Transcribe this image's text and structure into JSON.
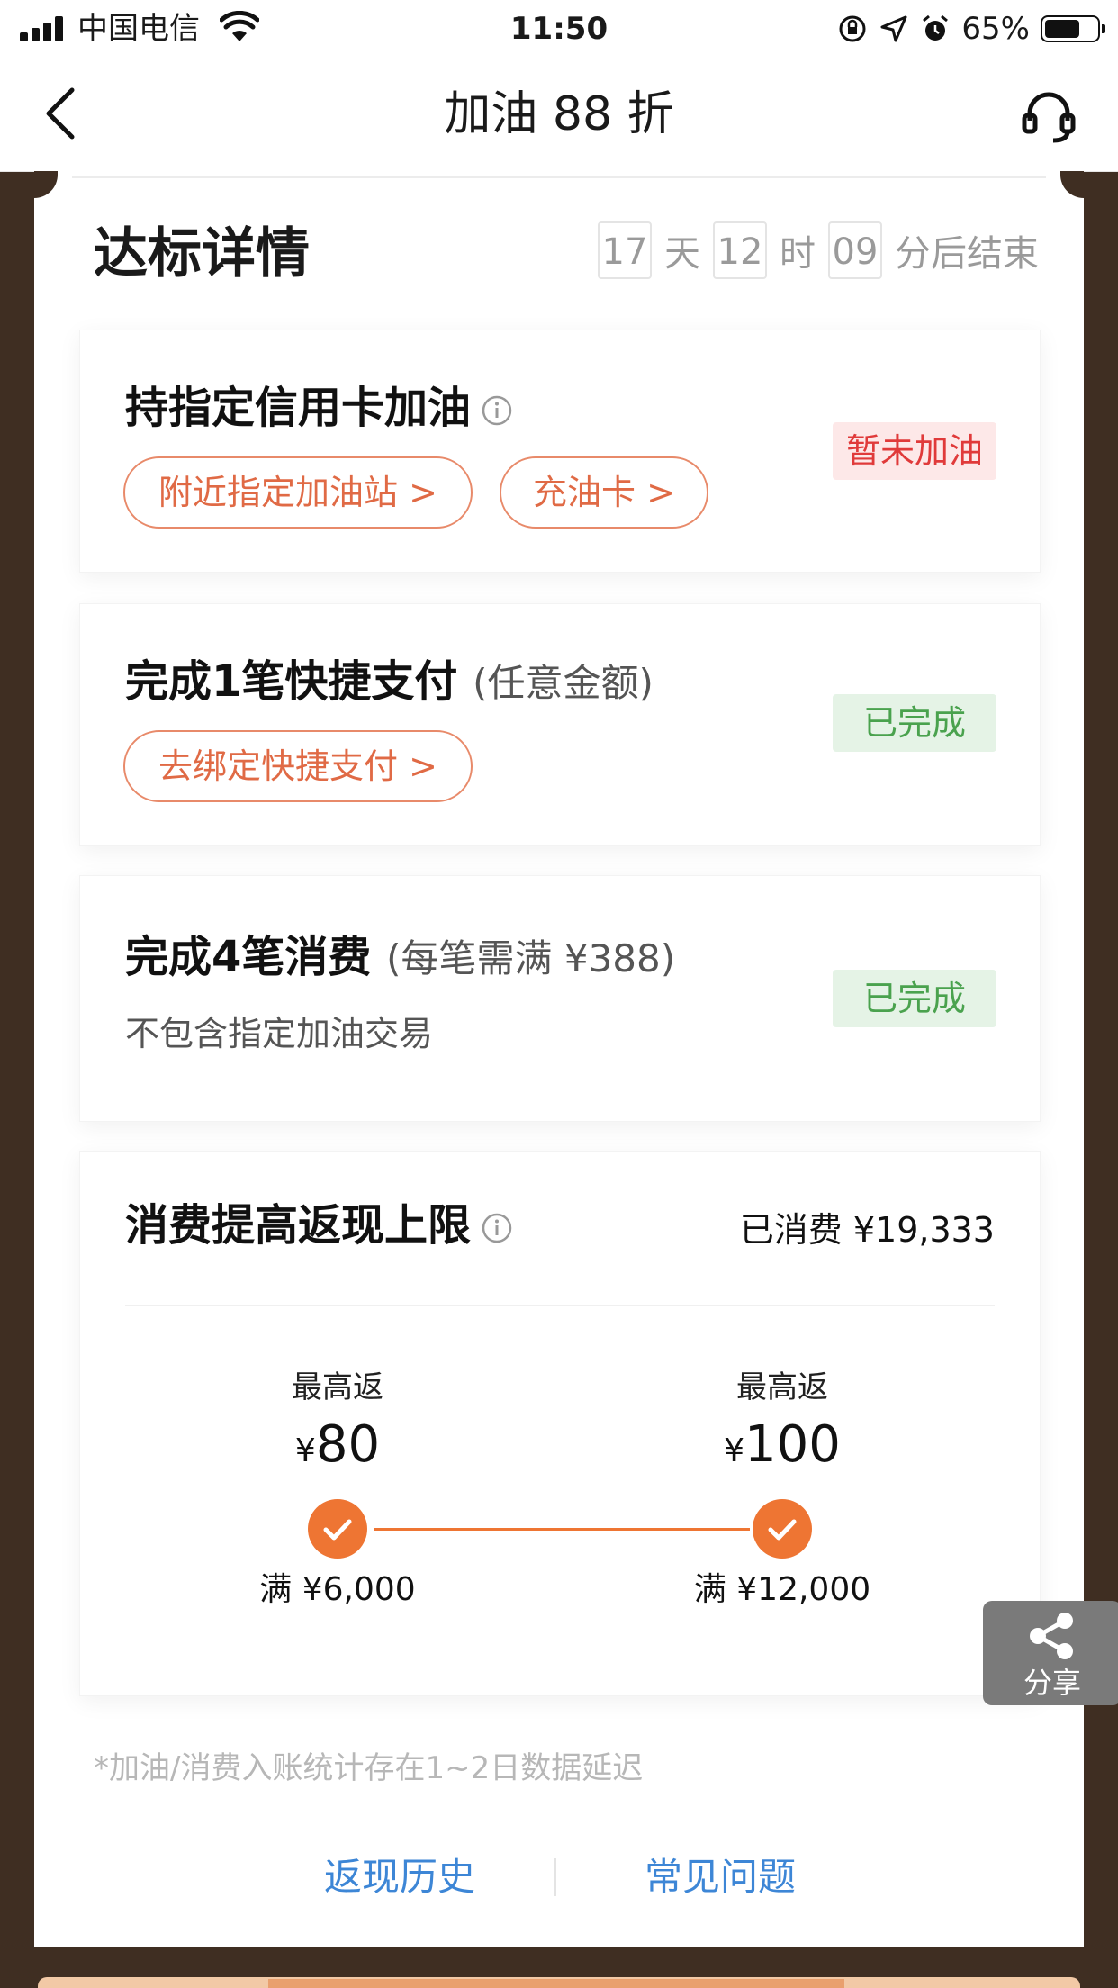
{
  "status_bar": {
    "carrier": "中国电信",
    "time": "11:50",
    "battery": "65%"
  },
  "nav": {
    "title": "加油 88 折"
  },
  "section": {
    "title": "达标详情",
    "countdown": {
      "days": "17",
      "days_unit": "天",
      "hours": "12",
      "hours_unit": "时",
      "minutes": "09",
      "suffix": "分后结束"
    }
  },
  "tasks": [
    {
      "title": "持指定信用卡加油",
      "buttons": [
        "附近指定加油站 >",
        "充油卡 >"
      ],
      "status": "暂未加油"
    },
    {
      "title": "完成1笔快捷支付",
      "note": "(任意金额)",
      "buttons": [
        "去绑定快捷支付 >"
      ],
      "status": "已完成"
    },
    {
      "title": "完成4笔消费",
      "note": "(每笔需满 ¥388)",
      "subtitle": "不包含指定加油交易",
      "status": "已完成"
    }
  ],
  "cap": {
    "title": "消费提高返现上限",
    "spent": "已消费 ¥19,333",
    "tiers": [
      {
        "label": "最高返",
        "currency": "¥",
        "amount": "80",
        "requirement": "满 ¥6,000"
      },
      {
        "label": "最高返",
        "currency": "¥",
        "amount": "100",
        "requirement": "满 ¥12,000"
      }
    ]
  },
  "footnote": "*加油/消费入账统计存在1~2日数据延迟",
  "links": {
    "history": "返现历史",
    "faq": "常见问题"
  },
  "share": {
    "label": "分享"
  },
  "colors": {
    "accent": "#ee7533",
    "link": "#3d86d6",
    "frame": "#3f2e22",
    "pending_text": "#e03a3a",
    "done_text": "#4aa24e"
  }
}
